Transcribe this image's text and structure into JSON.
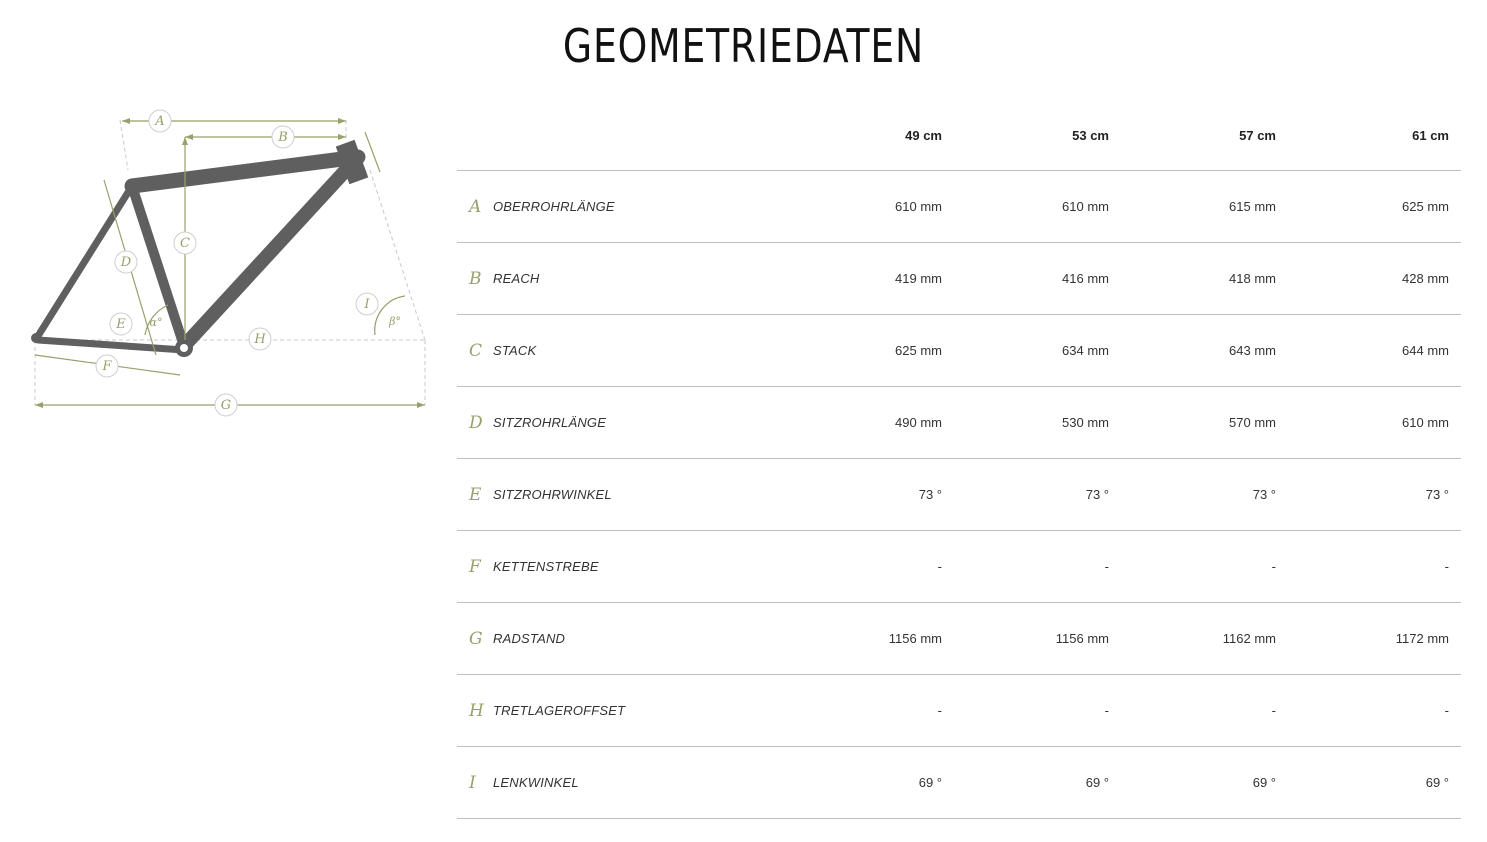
{
  "title": "GEOMETRIEDATEN",
  "colors": {
    "accent": "#98a16b",
    "frame": "#5f5f5f",
    "divider": "#bdbdbd"
  },
  "diagram": {
    "labels": {
      "A": "A",
      "B": "B",
      "C": "C",
      "D": "D",
      "E": "E",
      "F": "F",
      "G": "G",
      "H": "H",
      "I": "I",
      "alpha": "α°",
      "beta": "β°"
    }
  },
  "table": {
    "columns": [
      "49 cm",
      "53 cm",
      "57 cm",
      "61 cm"
    ],
    "rows": [
      {
        "letter": "A",
        "name": "OBERROHRLÄNGE",
        "values": [
          "610 mm",
          "610 mm",
          "615 mm",
          "625 mm"
        ]
      },
      {
        "letter": "B",
        "name": "REACH",
        "values": [
          "419 mm",
          "416 mm",
          "418 mm",
          "428 mm"
        ]
      },
      {
        "letter": "C",
        "name": "STACK",
        "values": [
          "625 mm",
          "634 mm",
          "643 mm",
          "644 mm"
        ]
      },
      {
        "letter": "D",
        "name": "SITZROHRLÄNGE",
        "values": [
          "490 mm",
          "530 mm",
          "570 mm",
          "610 mm"
        ]
      },
      {
        "letter": "E",
        "name": "SITZROHRWINKEL",
        "values": [
          "73 °",
          "73 °",
          "73 °",
          "73 °"
        ]
      },
      {
        "letter": "F",
        "name": "KETTENSTREBE",
        "values": [
          "-",
          "-",
          "-",
          "-"
        ]
      },
      {
        "letter": "G",
        "name": "RADSTAND",
        "values": [
          "1156 mm",
          "1156 mm",
          "1162 mm",
          "1172 mm"
        ]
      },
      {
        "letter": "H",
        "name": "TRETLAGEROFFSET",
        "values": [
          "-",
          "-",
          "-",
          "-"
        ]
      },
      {
        "letter": "I",
        "name": "LENKWINKEL",
        "values": [
          "69 °",
          "69 °",
          "69 °",
          "69 °"
        ]
      }
    ]
  }
}
